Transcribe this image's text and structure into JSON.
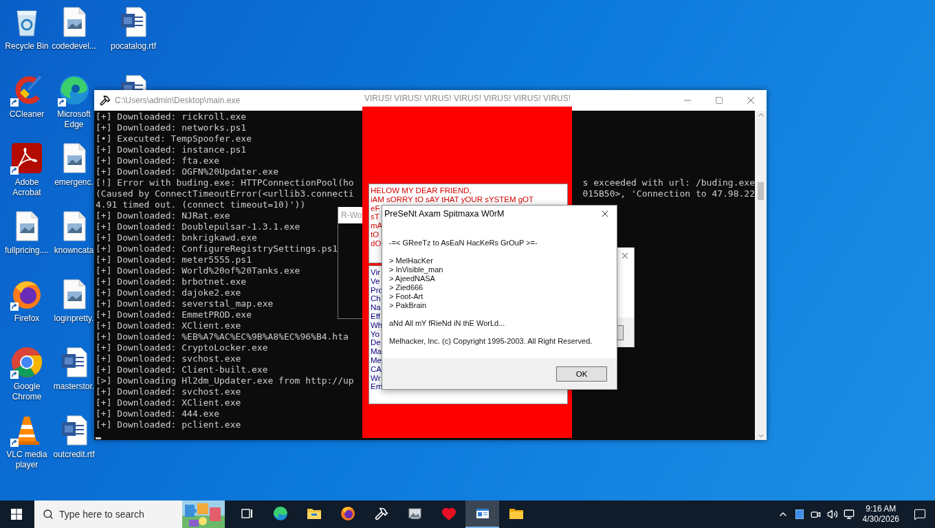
{
  "desktop_icons": [
    [
      {
        "kind": "recycle-bin",
        "label": "Recycle Bin"
      },
      {
        "kind": "cleaner",
        "label": "CCleaner",
        "shortcut": true
      },
      {
        "kind": "pdf",
        "label": "Adobe Acrobat",
        "shortcut": true
      },
      {
        "kind": "image-file",
        "label": "fullpricing...."
      },
      {
        "kind": "fox",
        "label": "Firefox",
        "shortcut": true
      },
      {
        "kind": "chrome",
        "label": "Google Chrome",
        "shortcut": true
      },
      {
        "kind": "cone",
        "label": "VLC media player",
        "shortcut": true
      }
    ],
    [
      {
        "kind": "image-file",
        "label": "codedevel..."
      },
      {
        "kind": "swirl",
        "label": "Microsoft Edge",
        "shortcut": true
      },
      {
        "kind": "image-file",
        "label": "emergenc."
      },
      {
        "kind": "image-file",
        "label": "knowncata"
      },
      {
        "kind": "image-file",
        "label": "loginpretty."
      },
      {
        "kind": "word",
        "label": "masterstor."
      },
      {
        "kind": "word",
        "label": "outcredit.rtf"
      }
    ],
    [
      {
        "kind": "word",
        "label": "pocatalog.rtf"
      },
      {
        "kind": "word"
      }
    ]
  ],
  "console": {
    "title": "C:\\Users\\admin\\Desktop\\main.exe",
    "lines": [
      {
        "text": "[+] Downloaded: rickroll.exe"
      },
      {
        "text": "[+] Downloaded: networks.ps1"
      },
      {
        "text": "[•] Executed: TempSpoofer.exe"
      },
      {
        "text": "[+] Downloaded: instance.ps1"
      },
      {
        "text": "[+] Downloaded: fta.exe"
      },
      {
        "text": "[+] Downloaded: OGFN%20Updater.exe"
      },
      {
        "text": "[!] Error with buding.exe: HTTPConnectionPool(ho",
        "right_text": "s exceeded with url: /buding.exe"
      },
      {
        "text": "(Caused by ConnectTimeoutError(<urllib3.connecti",
        "right_text": "015B50>, 'Connection to 47.98.22"
      },
      {
        "text": "4.91 timed out. (connect timeout=10)'))"
      },
      {
        "text": "[+] Downloaded: NJRat.exe"
      },
      {
        "text": "[+] Downloaded: Doublepulsar-1.3.1.exe"
      },
      {
        "text": "[+] Downloaded: bnkrigkawd.exe"
      },
      {
        "text": "[+] Downloaded: ConfigureRegistrySettings.ps1"
      },
      {
        "text": "[+] Downloaded: meter5555.ps1"
      },
      {
        "text": "[+] Downloaded: World%20of%20Tanks.exe"
      },
      {
        "text": "[+] Downloaded: brbotnet.exe"
      },
      {
        "text": "[+] Downloaded: dajoke2.exe"
      },
      {
        "text": "[+] Downloaded: severstal_map.exe"
      },
      {
        "text": "[+] Downloaded: EmmetPROD.exe"
      },
      {
        "text": "[+] Downloaded: XClient.exe"
      },
      {
        "text": "[+] Downloaded: %EB%A7%AC%EC%9B%A8%EC%96%B4.hta"
      },
      {
        "text": "[+] Downloaded: CryptoLocker.exe"
      },
      {
        "text": "[+] Downloaded: svchost.exe"
      },
      {
        "text": "[+] Downloaded: Client-built.exe"
      },
      {
        "text": "[>] Downloading Hl2dm_Updater.exe from http://up"
      },
      {
        "text": "[+] Downloaded: svchost.exe"
      },
      {
        "text": "[+] Downloaded: XClient.exe"
      },
      {
        "text": "[+] Downloaded: 444.exe"
      },
      {
        "text": "[+] Downloaded: pclient.exe"
      }
    ]
  },
  "back_window": {
    "title": "R-Wo"
  },
  "virus_window": {
    "title": "VIRUS! VIRUS! VIRUS! VIRUS! VIRUS! VIRUS! VIRUS!",
    "message_lines": [
      "HELOW MY DEAR FRIEND,",
      "iAM sORRY tO sAY tHAT yOUR sYSTEM gOT",
      "eF",
      "sT",
      "mA",
      "tO",
      "dO"
    ],
    "info_lines": [
      "Vir",
      "Ve",
      "Pro",
      "Ch",
      "Na",
      "Eff",
      "Wh",
      "Yo",
      "De",
      "Ma",
      "Me",
      "CA",
      "Wr",
      "Em"
    ]
  },
  "dialog": {
    "title": "PreSeNt Axam Spitmaxa W0rM",
    "greeting": "-=< GReeTz to AsEaN HacKeRs GrOuP >=-",
    "members": [
      "> MelHacKer",
      "> InVisible_man",
      "> AjeedNASA",
      "> Zied666",
      "> Foot-Art",
      "> PakBrain"
    ],
    "closing": "aNd All mY fRieNd iN thE WorLd...",
    "copyright": "Melhacker, Inc. (c) Copyright 1995-2003. All Right Reserved.",
    "button": "OK"
  },
  "taskbar": {
    "search_placeholder": "Type here to search",
    "apps": [
      {
        "kind": "task-view",
        "selected": false
      },
      {
        "kind": "swirl",
        "selected": false
      },
      {
        "kind": "file-explorer",
        "selected": false
      },
      {
        "kind": "fox",
        "selected": false
      },
      {
        "kind": "hammer",
        "selected": false
      },
      {
        "kind": "photo-app",
        "selected": false
      },
      {
        "kind": "heart",
        "selected": false
      },
      {
        "kind": "window-app",
        "selected": true
      },
      {
        "kind": "folder",
        "selected": false
      }
    ],
    "tray": [
      {
        "kind": "chevron"
      },
      {
        "kind": "app-square"
      },
      {
        "kind": "camera"
      },
      {
        "kind": "speaker"
      },
      {
        "kind": "network"
      }
    ],
    "time": "9:16 AM",
    "date": "4/30/2026"
  }
}
